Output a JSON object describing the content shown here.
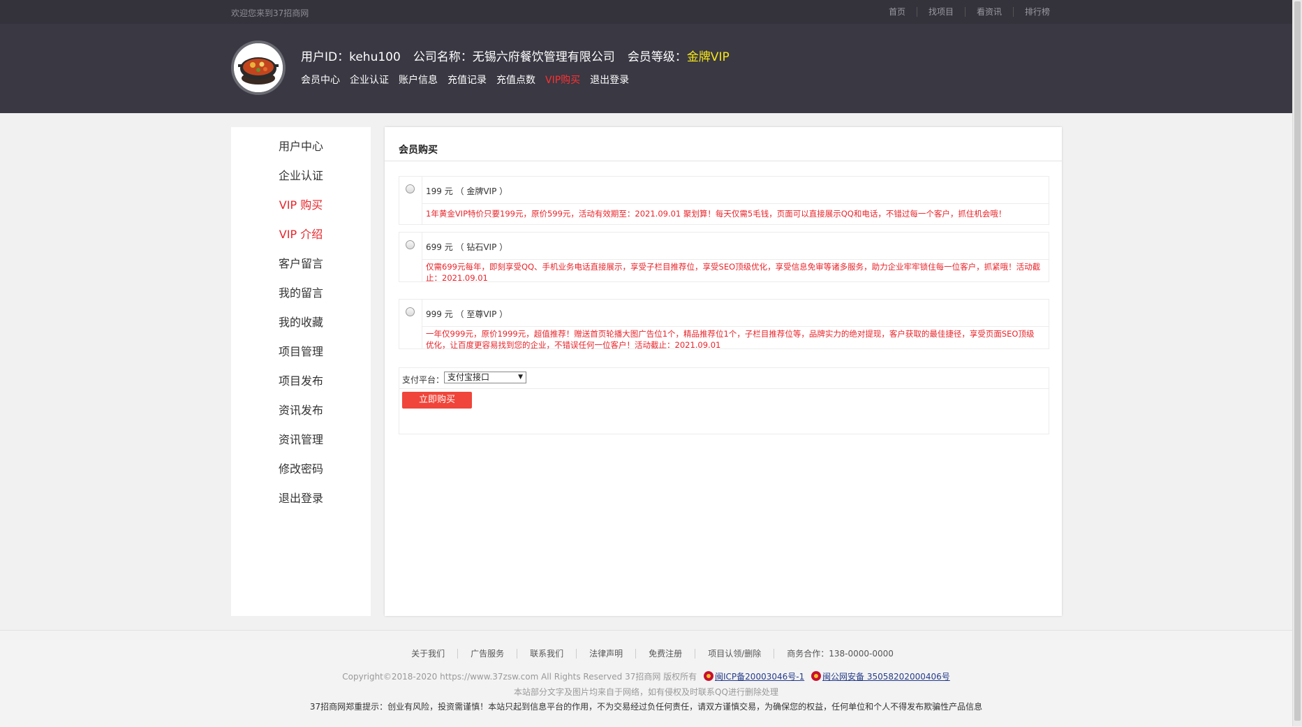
{
  "topbar": {
    "welcome": "欢迎您来到37招商网",
    "links": [
      "首页",
      "找项目",
      "看资讯",
      "排行榜"
    ]
  },
  "user": {
    "id_text": "用户ID：kehu100",
    "company_text": "公司名称：无锡六府餐饮管理有限公司",
    "level_prefix": "会员等级：",
    "level_value": "金牌VIP"
  },
  "usernav": [
    "会员中心",
    "企业认证",
    "账户信息",
    "充值记录",
    "充值点数",
    "VIP购买",
    "退出登录"
  ],
  "usernav_active": "VIP购买",
  "sidebar": {
    "items": [
      {
        "label": "用户中心",
        "red": false
      },
      {
        "label": "企业认证",
        "red": false
      },
      {
        "label": "VIP 购买",
        "red": true
      },
      {
        "label": "VIP 介绍",
        "red": true
      },
      {
        "label": "客户留言",
        "red": false
      },
      {
        "label": "我的留言",
        "red": false
      },
      {
        "label": "我的收藏",
        "red": false
      },
      {
        "label": "项目管理",
        "red": false
      },
      {
        "label": "项目发布",
        "red": false
      },
      {
        "label": "资讯发布",
        "red": false
      },
      {
        "label": "资讯管理",
        "red": false
      },
      {
        "label": "修改密码",
        "red": false
      },
      {
        "label": "退出登录",
        "red": false
      }
    ]
  },
  "main": {
    "title": "会员购买",
    "plans": [
      {
        "price": "199 元 （ 金牌VIP ）",
        "desc": "1年黄金VIP特价只要199元，原价599元，活动有效期至：2021.09.01 聚划算！每天仅需5毛钱，页面可以直接展示QQ和电话，不错过每一个客户，抓住机会哦！"
      },
      {
        "price": "699 元 （ 钻石VIP ）",
        "desc": "仅需699元每年，即刻享受QQ、手机业务电话直接展示，享受子栏目推荐位，享受SEO顶级优化，享受信息免审等诸多服务，助力企业牢牢锁住每一位客户，抓紧哦！活动截止：2021.09.01"
      },
      {
        "price": "999 元 （ 至尊VIP ）",
        "desc": "一年仅999元，原价1999元，超值推荐！赠送首页轮播大图广告位1个，精品推荐位1个，子栏目推荐位等，品牌实力的绝对提现，客户获取的最佳捷径，享受页面SEO顶级优化，让百度更容易找到您的企业，不错误任何一位客户！活动截止：2021.09.01"
      }
    ],
    "pay_label": "支付平台：",
    "pay_selected": "支付宝接口",
    "buy_button": "立即购买"
  },
  "footer": {
    "links": [
      "关于我们",
      "广告服务",
      "联系我们",
      "法律声明",
      "免费注册",
      "项目认领/删除"
    ],
    "contact": "商务合作：138-0000-0000",
    "copyright": "Copyright©2018-2020 https://www.37zsw.com All Rights Reserved  37招商网 版权所有",
    "icp": "闽ICP备20003046号-1",
    "police": "闽公网安备 35058202000406号",
    "notice1": "本站部分文字及图片均来自于网络，如有侵权及时联系QQ进行删除处理",
    "notice2": "37招商网郑重提示：创业有风险，投资需谨慎！本站只起到信息平台的作用，不为交易经过负任何责任，请双方谨慎交易，为确保您的权益，任何单位和个人不得发布欺骗性产品信息"
  },
  "colors": {
    "header_bg": "#393843",
    "topbar_bg": "#34333c",
    "accent_red": "#e8242a",
    "button_red": "#f0453a",
    "vip_gold": "#f7e616"
  }
}
